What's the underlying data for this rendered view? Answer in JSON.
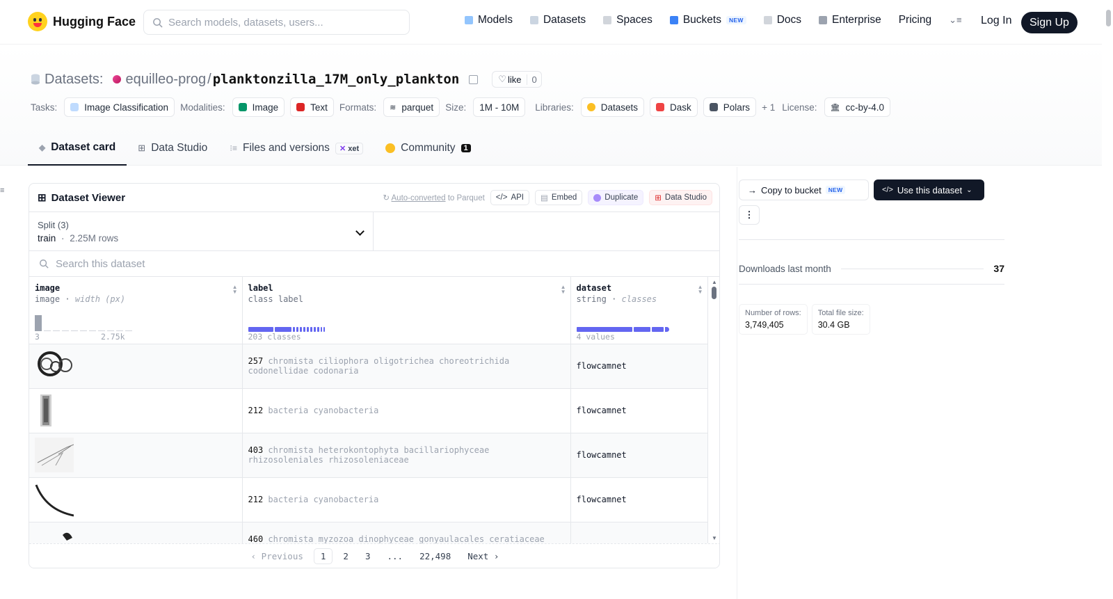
{
  "nav": {
    "brand": "Hugging Face",
    "search_placeholder": "Search models, datasets, users...",
    "links": [
      "Models",
      "Datasets",
      "Spaces",
      "Buckets",
      "Docs",
      "Enterprise",
      "Pricing"
    ],
    "buckets_badge": "NEW",
    "login": "Log In",
    "signup": "Sign Up"
  },
  "header": {
    "crumb": "Datasets:",
    "owner": "equilleo-prog",
    "slash": "/",
    "name": "planktonzilla_17M_only_plankton",
    "like_label": "like",
    "like_count": "0",
    "tags": {
      "tasks_label": "Tasks:",
      "task": "Image Classification",
      "modalities_label": "Modalities:",
      "modality_1": "Image",
      "modality_2": "Text",
      "formats_label": "Formats:",
      "format": "parquet",
      "size_label": "Size:",
      "size": "1M - 10M",
      "libraries_label": "Libraries:",
      "library_1": "Datasets",
      "library_2": "Dask",
      "library_3": "Polars",
      "library_more": "+ 1",
      "license_label": "License:",
      "license": "cc-by-4.0"
    }
  },
  "tabs": {
    "card": "Dataset card",
    "studio": "Data Studio",
    "files": "Files and versions",
    "xet": "xet",
    "community": "Community",
    "community_count": "1"
  },
  "viewer": {
    "title": "Dataset Viewer",
    "auto_link": "Auto-converted",
    "auto_suffix": "to Parquet",
    "api": "API",
    "embed": "Embed",
    "duplicate": "Duplicate",
    "data_studio": "Data Studio",
    "split_label": "Split (3)",
    "split_value": "train",
    "split_sep": "·",
    "split_rows": "2.25M rows",
    "search_placeholder": "Search this dataset",
    "columns": [
      {
        "name": "image",
        "type": "image",
        "sub": "width (px)",
        "foot_a": "3",
        "foot_b": "2.75k"
      },
      {
        "name": "label",
        "type": "class label",
        "sub": "",
        "foot_a": "203 classes",
        "foot_b": ""
      },
      {
        "name": "dataset",
        "type": "string",
        "sub": "classes",
        "foot_a": "4 values",
        "foot_b": ""
      }
    ],
    "image_histogram": [
      0.95,
      0.05,
      0.04,
      0.04,
      0.04,
      0.04,
      0.04,
      0.04,
      0.04,
      0.04,
      0.04
    ],
    "rows": [
      {
        "num": "257",
        "label": "chromista ciliophora oligotrichea choreotrichida codonellidae codonaria",
        "dataset": "flowcamnet"
      },
      {
        "num": "212",
        "label": "bacteria cyanobacteria",
        "dataset": "flowcamnet"
      },
      {
        "num": "403",
        "label": "chromista heterokontophyta bacillariophyceae rhizosoleniales rhizosoleniaceae",
        "dataset": "flowcamnet"
      },
      {
        "num": "212",
        "label": "bacteria cyanobacteria",
        "dataset": "flowcamnet"
      },
      {
        "num": "460",
        "label": "chromista myzozoa dinophyceae gonyaulacales ceratiaceae",
        "dataset": ""
      }
    ],
    "pager": {
      "prev": "Previous",
      "p1": "1",
      "p2": "2",
      "p3": "3",
      "ellipsis": "...",
      "last": "22,498",
      "next": "Next"
    }
  },
  "side": {
    "copy_bucket": "Copy to bucket",
    "copy_badge": "NEW",
    "use_dataset": "Use this dataset",
    "downloads_label": "Downloads last month",
    "downloads_value": "37",
    "rows_label": "Number of rows:",
    "rows_value": "3,749,405",
    "size_label": "Total file size:",
    "size_value": "30.4 GB"
  },
  "colors": {
    "accent": "#6366f1",
    "dark": "#111827",
    "muted": "#6b7280"
  }
}
